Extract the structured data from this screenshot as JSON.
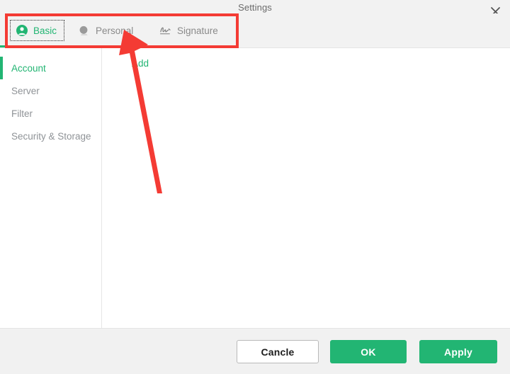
{
  "window": {
    "title": "Settings",
    "close_icon": "close-icon",
    "accent_color": "#22b573",
    "annotation_color": "#f43b34"
  },
  "tabs": [
    {
      "id": "basic",
      "label": "Basic",
      "icon": "person-filled-circle-icon",
      "active": true
    },
    {
      "id": "personal",
      "label": "Personal",
      "icon": "person-silhouette-icon",
      "active": false
    },
    {
      "id": "signature",
      "label": "Signature",
      "icon": "signature-pen-icon",
      "active": false
    }
  ],
  "sidebar": {
    "items": [
      {
        "id": "account",
        "label": "Account",
        "active": true
      },
      {
        "id": "server",
        "label": "Server",
        "active": false
      },
      {
        "id": "filter",
        "label": "Filter",
        "active": false
      },
      {
        "id": "security",
        "label": "Security & Storage",
        "active": false
      }
    ]
  },
  "main": {
    "add_label": "Add"
  },
  "footer": {
    "cancel_label": "Cancle",
    "ok_label": "OK",
    "apply_label": "Apply"
  }
}
